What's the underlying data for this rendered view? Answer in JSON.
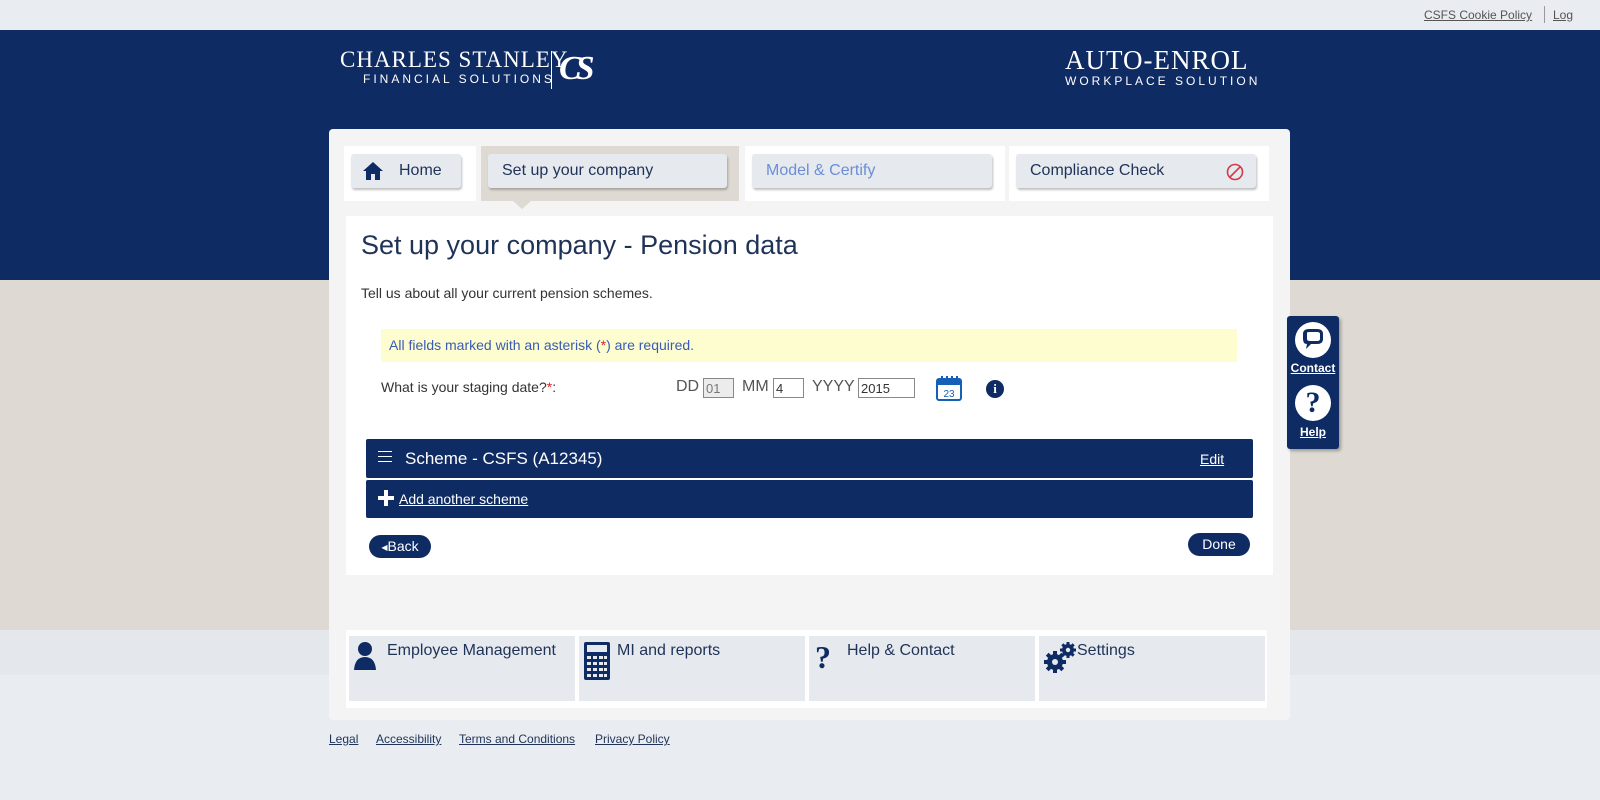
{
  "topbar": {
    "cookie_policy": "CSFS Cookie Policy",
    "log": "Log"
  },
  "header": {
    "logo_left": {
      "line1": "CHARLES STANLEY",
      "line2": "FINANCIAL SOLUTIONS",
      "monogram": "CS"
    },
    "logo_right": {
      "line1": "AUTO-ENROL",
      "line2": "WORKPLACE SOLUTION"
    }
  },
  "tabs": [
    {
      "label": "Home",
      "icon": "home-icon"
    },
    {
      "label": "Set up your company",
      "active": true
    },
    {
      "label": "Model & Certify",
      "disabled_look": true
    },
    {
      "label": "Compliance Check",
      "icon": "blocked-icon"
    }
  ],
  "main": {
    "title": "Set up your company - Pension data",
    "intro": "Tell us about all your current pension schemes.",
    "notice_before": "All fields marked with an asterisk (",
    "notice_asterisk": "*",
    "notice_after": ") are required."
  },
  "staging": {
    "question": "What is your staging date?",
    "required_mark": "*",
    "colon": ":",
    "dd_label": "DD",
    "dd_value": "01",
    "mm_label": "MM",
    "mm_value": "4",
    "yyyy_label": "YYYY",
    "yyyy_value": "2015",
    "calendar_day": "23",
    "info_glyph": "i"
  },
  "scheme": {
    "title": "Scheme - CSFS (A12345)",
    "edit_label": "Edit"
  },
  "add_scheme": "Add another scheme",
  "actions": {
    "back": "Back",
    "done": "Done"
  },
  "bottom_nav": [
    {
      "label": "Employee Management",
      "icon": "person-icon"
    },
    {
      "label": "MI and reports",
      "icon": "calculator-icon"
    },
    {
      "label": "Help & Contact",
      "icon": "question-icon"
    },
    {
      "label": "Settings",
      "icon": "gears-icon"
    }
  ],
  "side_widget": {
    "contact": "Contact",
    "help": "Help"
  },
  "footer": {
    "links": [
      "Legal",
      "Accessibility",
      "Terms and Conditions",
      "Privacy Policy"
    ]
  },
  "colors": {
    "brand_navy": "#0f2b63",
    "beige": "#dedad3",
    "notice_bg": "#fdfdd0",
    "required_red": "#dd2222",
    "disabled_tab_text": "#6b8ed6"
  }
}
